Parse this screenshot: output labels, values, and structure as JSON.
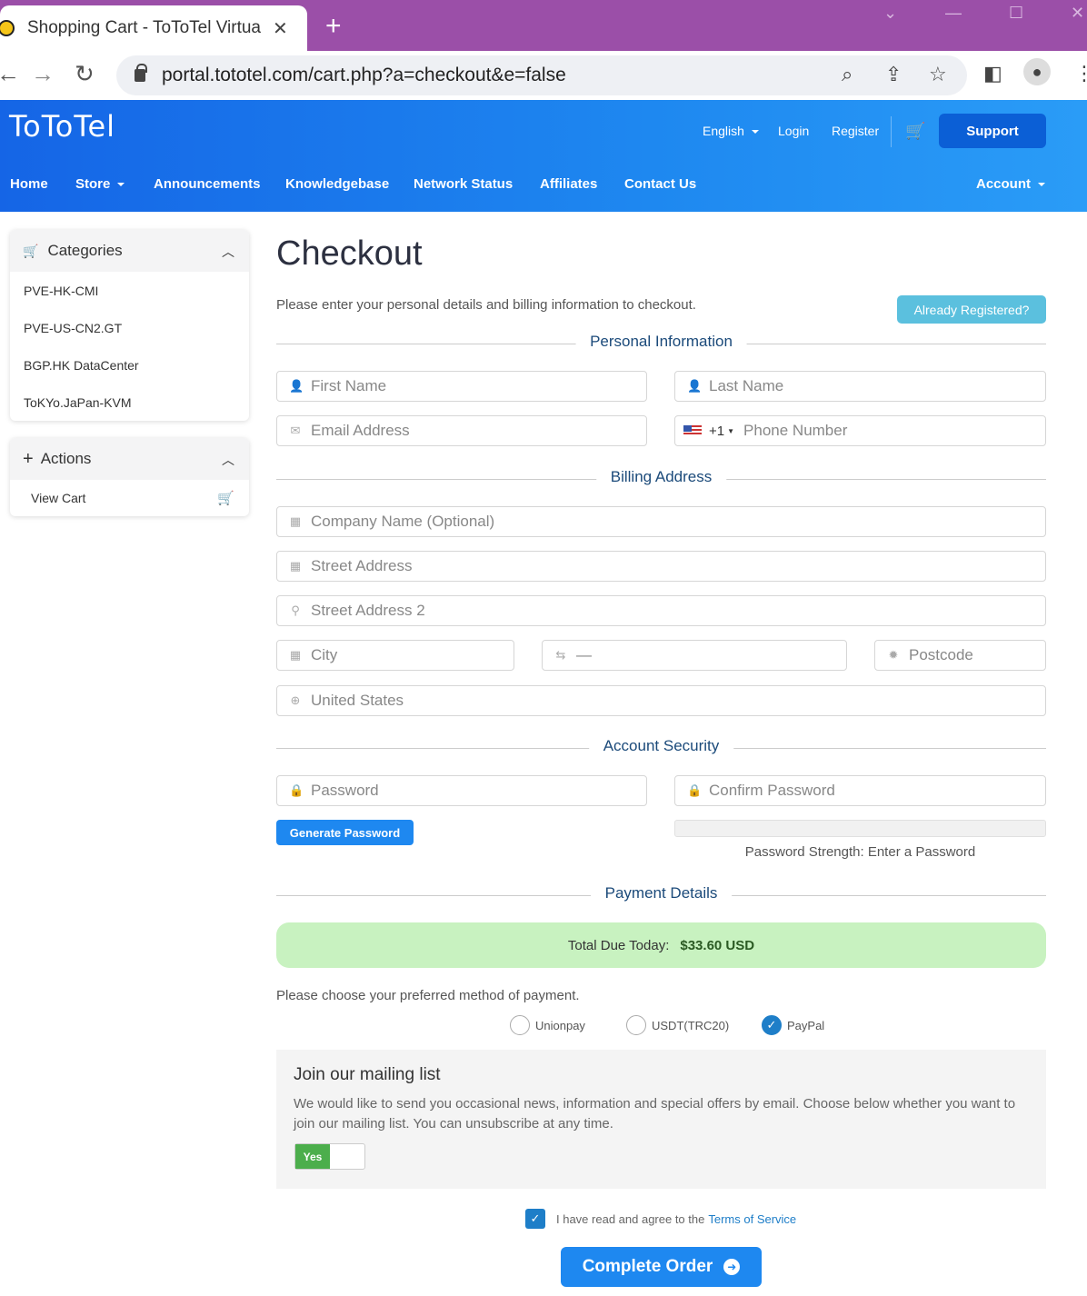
{
  "browser": {
    "tab_title": "Shopping Cart - ToToTel Virtua",
    "url": "portal.tototel.com/cart.php?a=checkout&e=false"
  },
  "header": {
    "logo": "ToToTel",
    "language": "English",
    "login": "Login",
    "register": "Register",
    "support": "Support"
  },
  "nav": {
    "items": [
      "Home",
      "Store",
      "Announcements",
      "Knowledgebase",
      "Network Status",
      "Affiliates",
      "Contact Us"
    ],
    "account": "Account"
  },
  "sidebar": {
    "categories_title": "Categories",
    "categories": [
      "PVE-HK-CMI",
      "PVE-US-CN2.GT",
      "BGP.HK DataCenter",
      "ToKYo.JaPan-KVM"
    ],
    "actions_title": "Actions",
    "actions": [
      "View Cart"
    ]
  },
  "main": {
    "title": "Checkout",
    "intro": "Please enter your personal details and billing information to checkout.",
    "already_registered": "Already Registered?",
    "sections": {
      "personal": "Personal Information",
      "billing": "Billing Address",
      "security": "Account Security",
      "payment": "Payment Details"
    },
    "fields": {
      "first_name": "First Name",
      "last_name": "Last Name",
      "email": "Email Address",
      "phone_code": "+1",
      "phone": "Phone Number",
      "company": "Company Name (Optional)",
      "street": "Street Address",
      "street2": "Street Address 2",
      "city": "City",
      "state": "—",
      "postcode": "Postcode",
      "country": "United States",
      "password": "Password",
      "confirm_password": "Confirm Password"
    },
    "generate_password": "Generate Password",
    "password_strength": "Password Strength: Enter a Password",
    "total_label": "Total Due Today:",
    "total_value": "$33.60 USD",
    "payment_prompt": "Please choose your preferred method of payment.",
    "payment_methods": [
      "Unionpay",
      "USDT(TRC20)",
      "PayPal"
    ],
    "payment_selected": "PayPal",
    "mailing_title": "Join our mailing list",
    "mailing_desc": "We would like to send you occasional news, information and special offers by email. Choose below whether you want to join our mailing list. You can unsubscribe at any time.",
    "mailing_toggle": "Yes",
    "tos_text": "I have read and agree to the",
    "tos_link": "Terms of Service",
    "complete_order": "Complete Order"
  }
}
